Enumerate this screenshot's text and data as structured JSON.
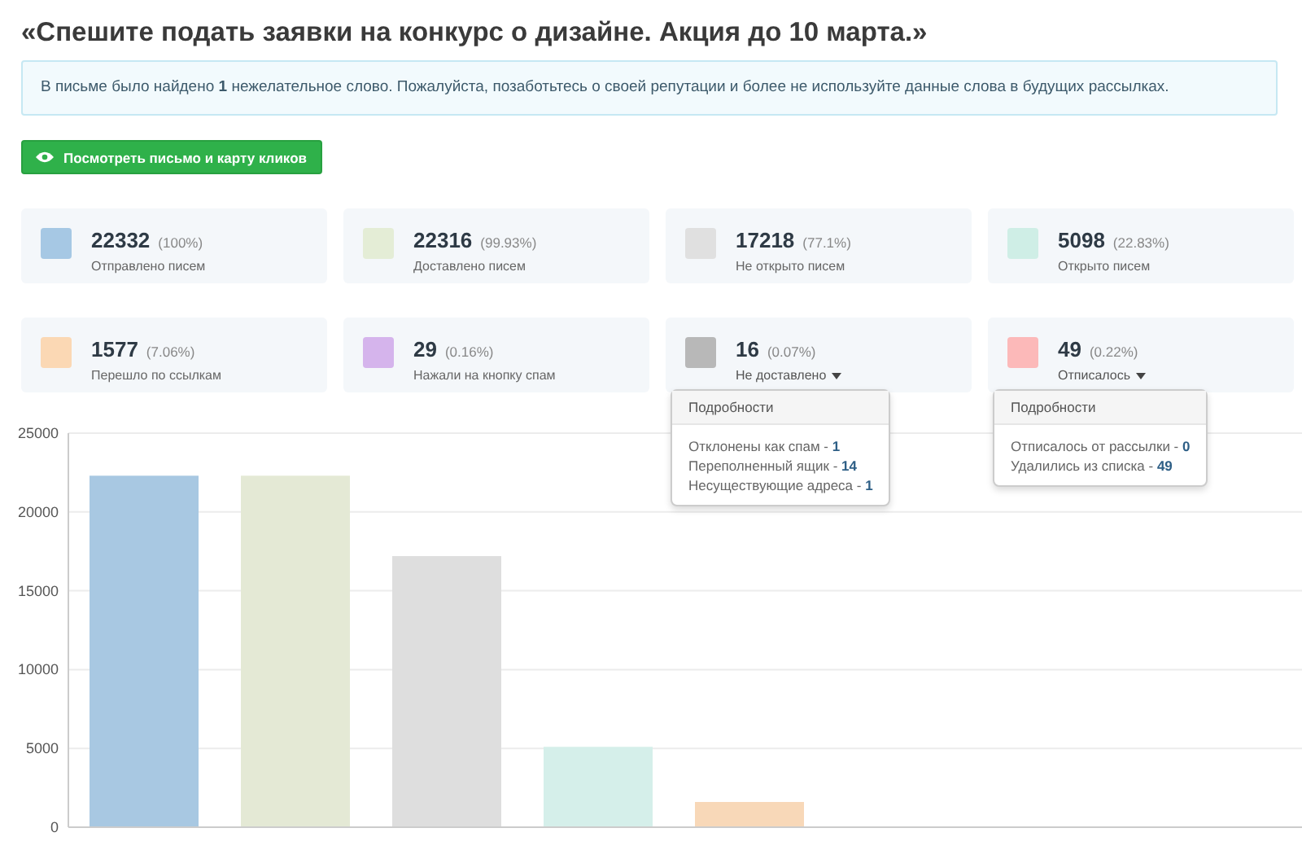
{
  "title": "«Спешите подать заявки на конкурс о дизайне. Акция до 10 марта.»",
  "alert": "В письме было найдено **1** нежелательное слово. Пожалуйста, позаботьтесь о своей репутации и более не используйте данные слова в будущих рассылках.",
  "view_button": "Посмотреть письмо и карту кликов",
  "stats": [
    {
      "value": "22332",
      "percent": "(100%)",
      "label": "Отправлено писем",
      "color": "#a6c8e4"
    },
    {
      "value": "22316",
      "percent": "(99.93%)",
      "label": "Доставлено писем",
      "color": "#e4edd6"
    },
    {
      "value": "17218",
      "percent": "(77.1%)",
      "label": "Не открыто писем",
      "color": "#e0e0e0"
    },
    {
      "value": "5098",
      "percent": "(22.83%)",
      "label": "Открыто писем",
      "color": "#cfeee6"
    },
    {
      "value": "1577",
      "percent": "(7.06%)",
      "label": "Перешло по ссылкам",
      "color": "#fbd8b4"
    },
    {
      "value": "29",
      "percent": "(0.16%)",
      "label": "Нажали на кнопку спам",
      "color": "#d5b4ec"
    },
    {
      "value": "16",
      "percent": "(0.07%)",
      "label": "Не доставлено",
      "color": "#b8b8b8",
      "expanded": true,
      "details_title": "Подробности",
      "details": [
        {
          "label": "Отклонены как спам - ",
          "value": "1"
        },
        {
          "label": "Переполненный ящик - ",
          "value": "14"
        },
        {
          "label": "Несуществующие адреса - ",
          "value": "1"
        }
      ]
    },
    {
      "value": "49",
      "percent": "(0.22%)",
      "label": "Отписалось",
      "color": "#fcb9b9",
      "expanded": true,
      "details_title": "Подробности",
      "details": [
        {
          "label": "Отписалось от рассылки - ",
          "value": "0"
        },
        {
          "label": "Удалились из списка - ",
          "value": "49"
        }
      ]
    }
  ],
  "chart": {
    "chart_data": {
      "type": "bar",
      "ylim": [
        0,
        25000
      ],
      "yticks": [
        0,
        5000,
        10000,
        15000,
        20000,
        25000
      ],
      "grid": true,
      "stacked": true,
      "series": [
        {
          "color": "#a8c8e2",
          "values": [
            22300,
            null,
            null,
            null,
            null
          ]
        },
        {
          "color": "#e4e9d5",
          "values": [
            null,
            22300,
            null,
            null,
            null
          ]
        },
        {
          "color": "#dedede",
          "values": [
            null,
            null,
            17200,
            null,
            null
          ]
        },
        {
          "color": "#d5efea",
          "values": [
            null,
            null,
            null,
            5100,
            null
          ]
        },
        {
          "color": "#f8d8b8",
          "values": [
            null,
            null,
            null,
            null,
            1600
          ]
        }
      ]
    }
  }
}
